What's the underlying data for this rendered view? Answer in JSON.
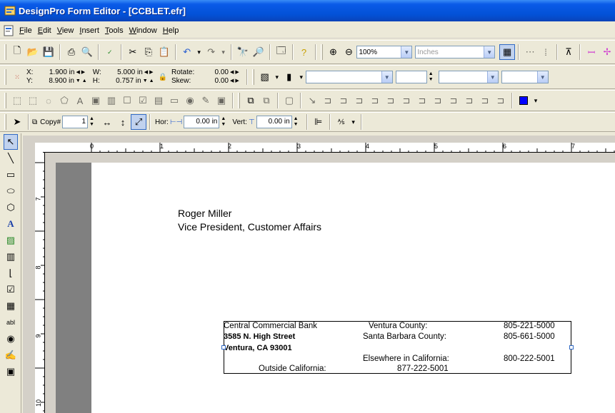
{
  "window": {
    "title": "DesignPro Form Editor - [CCBLET.efr]"
  },
  "menu": [
    "File",
    "Edit",
    "View",
    "Insert",
    "Tools",
    "Window",
    "Help"
  ],
  "menu_ul": [
    "F",
    "E",
    "V",
    "I",
    "T",
    "W",
    "H"
  ],
  "toolbar1": {
    "zoom": "100%",
    "units": "Inches"
  },
  "toolbar2": {
    "x_label": "X:",
    "x_value": "1.900 in",
    "y_label": "Y:",
    "y_value": "8.900 in",
    "w_label": "W:",
    "w_value": "5.000 in",
    "h_label": "H:",
    "h_value": "0.757 in",
    "rotate_label": "Rotate:",
    "rotate_value": "0.00",
    "skew_label": "Skew:",
    "skew_value": "0.00"
  },
  "toolbar4": {
    "copy_label": "Copy#",
    "copy_value": "1",
    "hor_label": "Hor:",
    "hor_value": "0.00 in",
    "vert_label": "Vert:",
    "vert_value": "0.00 in"
  },
  "ruler_h": [
    "0",
    "1",
    "2",
    "3",
    "4",
    "5",
    "6",
    "7"
  ],
  "ruler_v": [
    "7",
    "8",
    "9",
    "10"
  ],
  "letter": {
    "name": "Roger Miller",
    "position": "Vice President, Customer Affairs"
  },
  "address": {
    "bank": "Central Commercial Bank",
    "street": "3585 N. High Street",
    "city": "Ventura, CA 93001",
    "outside_label": "Outside California:",
    "ventura_label": "Ventura County:",
    "sb_label": "Santa Barbara County:",
    "elsewhere_label": "Elsewhere in California:",
    "outside_phone": "877-222-5001",
    "ventura_phone": "805-221-5000",
    "sb_phone": "805-661-5000",
    "elsewhere_phone": "800-222-5001"
  }
}
